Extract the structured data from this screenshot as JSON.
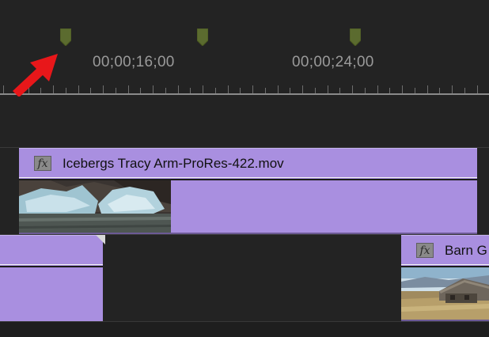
{
  "ruler": {
    "timecodes": [
      "00;00;16;00",
      "00;00;24;00"
    ]
  },
  "clips": {
    "icebergs": {
      "name": "Icebergs Tracy Arm-ProRes-422.mov",
      "effect_badge": "fx"
    },
    "barn": {
      "name": "Barn G",
      "effect_badge": "fx"
    }
  },
  "colors": {
    "clip_fill": "#a98fe0",
    "marker": "#5b6b2f",
    "background": "#232323",
    "annotation_arrow": "#e8171a"
  }
}
